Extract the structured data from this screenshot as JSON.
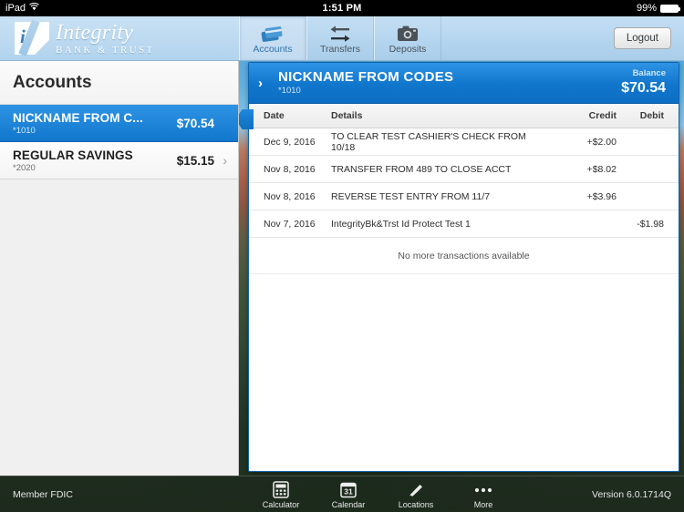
{
  "status_bar": {
    "device": "iPad",
    "wifi_icon": "wifi-icon",
    "time": "1:51 PM",
    "battery_percent": "99%",
    "battery_icon": "battery-icon"
  },
  "brand": {
    "name": "Integrity",
    "tagline": "BANK & TRUST",
    "logo_icon": "integrity-logo-icon"
  },
  "nav": {
    "tabs": [
      {
        "label": "Accounts",
        "icon": "credit-cards-icon",
        "active": true
      },
      {
        "label": "Transfers",
        "icon": "transfer-arrows-icon",
        "active": false
      },
      {
        "label": "Deposits",
        "icon": "camera-icon",
        "active": false
      }
    ],
    "logout_label": "Logout"
  },
  "sidebar": {
    "title": "Accounts",
    "accounts": [
      {
        "name": "NICKNAME FROM C...",
        "number": "*1010",
        "balance": "$70.54",
        "selected": true,
        "chevron": "›"
      },
      {
        "name": "REGULAR SAVINGS",
        "number": "*2020",
        "balance": "$15.15",
        "selected": false,
        "chevron": "›"
      }
    ]
  },
  "detail": {
    "expand_icon": "›",
    "title": "NICKNAME FROM CODES",
    "number": "*1010",
    "balance_label": "Balance",
    "balance_amount": "$70.54",
    "columns": {
      "date": "Date",
      "details": "Details",
      "credit": "Credit",
      "debit": "Debit"
    },
    "transactions": [
      {
        "date": "Dec 9, 2016",
        "details": "TO CLEAR TEST CASHIER'S CHECK FROM 10/18",
        "credit": "+$2.00",
        "debit": ""
      },
      {
        "date": "Nov 8, 2016",
        "details": "TRANSFER FROM 489 TO CLOSE ACCT",
        "credit": "+$8.02",
        "debit": ""
      },
      {
        "date": "Nov 8, 2016",
        "details": "REVERSE TEST ENTRY FROM 11/7",
        "credit": "+$3.96",
        "debit": ""
      },
      {
        "date": "Nov 7, 2016",
        "details": "IntegrityBk&Trst Id Protect Test 1",
        "credit": "",
        "debit": "-$1.98"
      }
    ],
    "footer_message": "No more transactions available"
  },
  "bottom_bar": {
    "fdic": "Member FDIC",
    "version": "Version 6.0.1714Q",
    "tools": [
      {
        "label": "Calculator",
        "icon": "calculator-icon"
      },
      {
        "label": "Calendar",
        "icon": "calendar-icon",
        "day": "31"
      },
      {
        "label": "Locations",
        "icon": "map-pin-icon"
      },
      {
        "label": "More",
        "icon": "ellipsis-icon"
      }
    ]
  },
  "colors": {
    "accent_blue": "#1077cd",
    "header_blue": "#2e93e4",
    "toolbar_blue": "#b6d6ef"
  }
}
